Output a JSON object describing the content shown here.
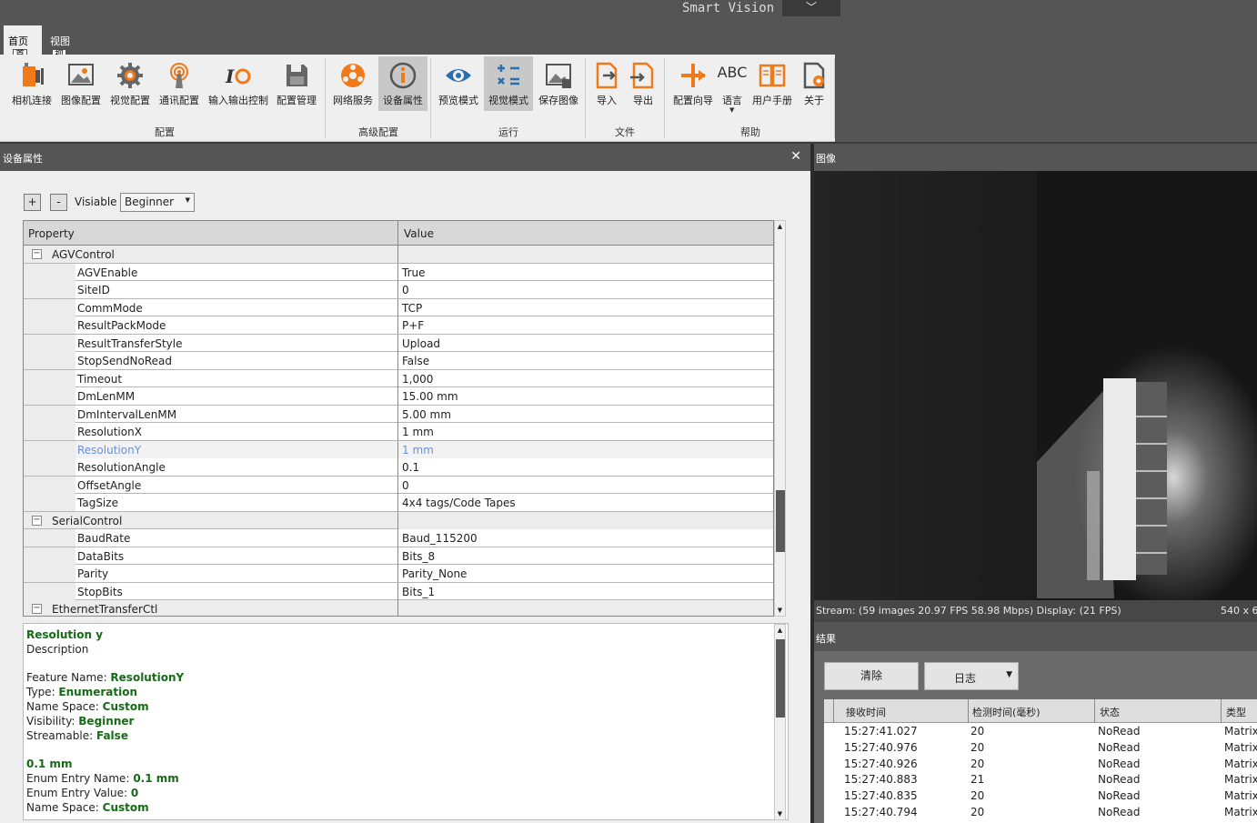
{
  "window": {
    "title": "Smart Vision",
    "title_dropdown": "﹀"
  },
  "menu": [
    {
      "label": "首页",
      "key": "首"
    },
    {
      "label": "视图",
      "key": "视"
    }
  ],
  "ribbon": {
    "buttons": [
      {
        "label": "相机连接",
        "icon": "camera-connect-icon"
      },
      {
        "label": "图像配置",
        "icon": "image-config-icon"
      },
      {
        "label": "视觉配置",
        "icon": "gear-icon"
      },
      {
        "label": "通讯配置",
        "icon": "broadcast-icon"
      },
      {
        "label": "输入输出控制",
        "icon": "io-icon"
      },
      {
        "label": "配置管理",
        "icon": "save-icon"
      },
      {
        "label": "网络服务",
        "icon": "network-icon"
      },
      {
        "label": "设备属性",
        "icon": "info-icon"
      },
      {
        "label": "预览模式",
        "icon": "eye-icon"
      },
      {
        "label": "视觉模式",
        "icon": "calc-icon"
      },
      {
        "label": "保存图像",
        "icon": "save-image-icon"
      },
      {
        "label": "导入",
        "icon": "import-icon"
      },
      {
        "label": "导出",
        "icon": "export-icon"
      },
      {
        "label": "配置向导",
        "icon": "wizard-icon"
      },
      {
        "label": "语言",
        "icon": "language-icon",
        "text": "ABC"
      },
      {
        "label": "用户手册",
        "icon": "book-icon"
      },
      {
        "label": "关于",
        "icon": "about-icon"
      }
    ],
    "groups": [
      "配置",
      "高级配置",
      "运行",
      "文件",
      "帮助"
    ]
  },
  "left_panel": {
    "title": "设备属性",
    "close": "✕",
    "expand": "+",
    "collapse": "-",
    "visibility_label": "Visiable",
    "visibility_value": "Beginner",
    "grid": {
      "header_property": "Property",
      "header_value": "Value",
      "rows": [
        {
          "type": "cat",
          "name": "AGVControl",
          "toggle": "−"
        },
        {
          "name": "AGVEnable",
          "value": "True"
        },
        {
          "name": "SiteID",
          "value": "0"
        },
        {
          "name": "CommMode",
          "value": "TCP"
        },
        {
          "name": "ResultPackMode",
          "value": "P+F"
        },
        {
          "name": "ResultTransferStyle",
          "value": "Upload"
        },
        {
          "name": "StopSendNoRead",
          "value": "False"
        },
        {
          "name": "Timeout",
          "value": "1,000"
        },
        {
          "name": "DmLenMM",
          "value": "15.00 mm"
        },
        {
          "name": "DmIntervalLenMM",
          "value": "5.00 mm"
        },
        {
          "name": "ResolutionX",
          "value": "1 mm"
        },
        {
          "name": "ResolutionY",
          "value": "1 mm",
          "selected": true
        },
        {
          "name": "ResolutionAngle",
          "value": "0.1"
        },
        {
          "name": "OffsetAngle",
          "value": "0"
        },
        {
          "name": "TagSize",
          "value": "4x4 tags/Code Tapes"
        },
        {
          "type": "cat",
          "name": "SerialControl",
          "toggle": "−"
        },
        {
          "name": "BaudRate",
          "value": "Baud_115200"
        },
        {
          "name": "DataBits",
          "value": "Bits_8"
        },
        {
          "name": "Parity",
          "value": "Parity_None"
        },
        {
          "name": "StopBits",
          "value": "Bits_1"
        },
        {
          "type": "cat",
          "name": "EthernetTransferCtl",
          "toggle": "−"
        }
      ]
    },
    "description": {
      "title": "Resolution y",
      "subtitle": "Description",
      "feature_name_label": "Feature Name: ",
      "feature_name": "ResolutionY",
      "type_label": "Type: ",
      "type": "Enumeration",
      "namespace_label": "Name Space: ",
      "namespace": "Custom",
      "visibility_label": "Visibility: ",
      "visibility": "Beginner",
      "streamable_label": "Streamable: ",
      "streamable": "False",
      "enum_title": "0.1 mm",
      "enum_name_label": "Enum Entry Name: ",
      "enum_name": "0.1 mm",
      "enum_value_label": "Enum Entry Value: ",
      "enum_value": "0",
      "enum_ns_label": "Name Space: ",
      "enum_ns": "Custom"
    }
  },
  "image_panel": {
    "title": "图像",
    "stream": "Stream: (59 images 20.97 FPS 58.98 Mbps) Display: (21 FPS)",
    "resolution": "540 x 6"
  },
  "results": {
    "title": "结果",
    "clear": "清除",
    "log": "日志",
    "columns": [
      "接收时间",
      "检测时间(毫秒)",
      "状态",
      "类型"
    ],
    "rows": [
      [
        "15:27:41.027",
        "20",
        "NoRead",
        "Matrix"
      ],
      [
        "15:27:40.976",
        "20",
        "NoRead",
        "Matrix"
      ],
      [
        "15:27:40.926",
        "20",
        "NoRead",
        "Matrix"
      ],
      [
        "15:27:40.883",
        "21",
        "NoRead",
        "Matrix"
      ],
      [
        "15:27:40.835",
        "20",
        "NoRead",
        "Matrix"
      ],
      [
        "15:27:40.794",
        "20",
        "NoRead",
        "Matrix"
      ]
    ]
  },
  "colors": {
    "accent_orange": "#f07a1a",
    "accent_blue": "#2a6fb0",
    "green_text": "#156b15",
    "selected_blue": "#6a8fd8"
  }
}
